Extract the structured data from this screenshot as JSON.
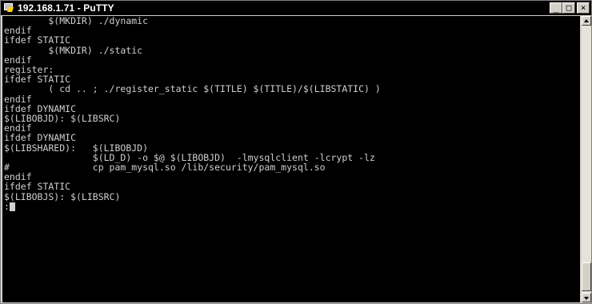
{
  "window": {
    "title": "192.168.1.71 - PuTTY",
    "icon": "putty-icon",
    "buttons": {
      "minimize": "_",
      "maximize": "□",
      "close": "×"
    }
  },
  "terminal": {
    "lines": [
      "        $(MKDIR) ./dynamic",
      "endif",
      "ifdef STATIC",
      "        $(MKDIR) ./static",
      "endif",
      "",
      "register:",
      "ifdef STATIC",
      "        ( cd .. ; ./register_static $(TITLE) $(TITLE)/$(LIBSTATIC) )",
      "endif",
      "",
      "ifdef DYNAMIC",
      "$(LIBOBJD): $(LIBSRC)",
      "endif",
      "",
      "ifdef DYNAMIC",
      "$(LIBSHARED):   $(LIBOBJD)",
      "                $(LD_D) -o $@ $(LIBOBJD)  -lmysqlclient -lcrypt -lz",
      "#               cp pam_mysql.so /lib/security/pam_mysql.so",
      "endif",
      "",
      "ifdef STATIC",
      "$(LIBOBJS): $(LIBSRC)",
      ":"
    ]
  }
}
